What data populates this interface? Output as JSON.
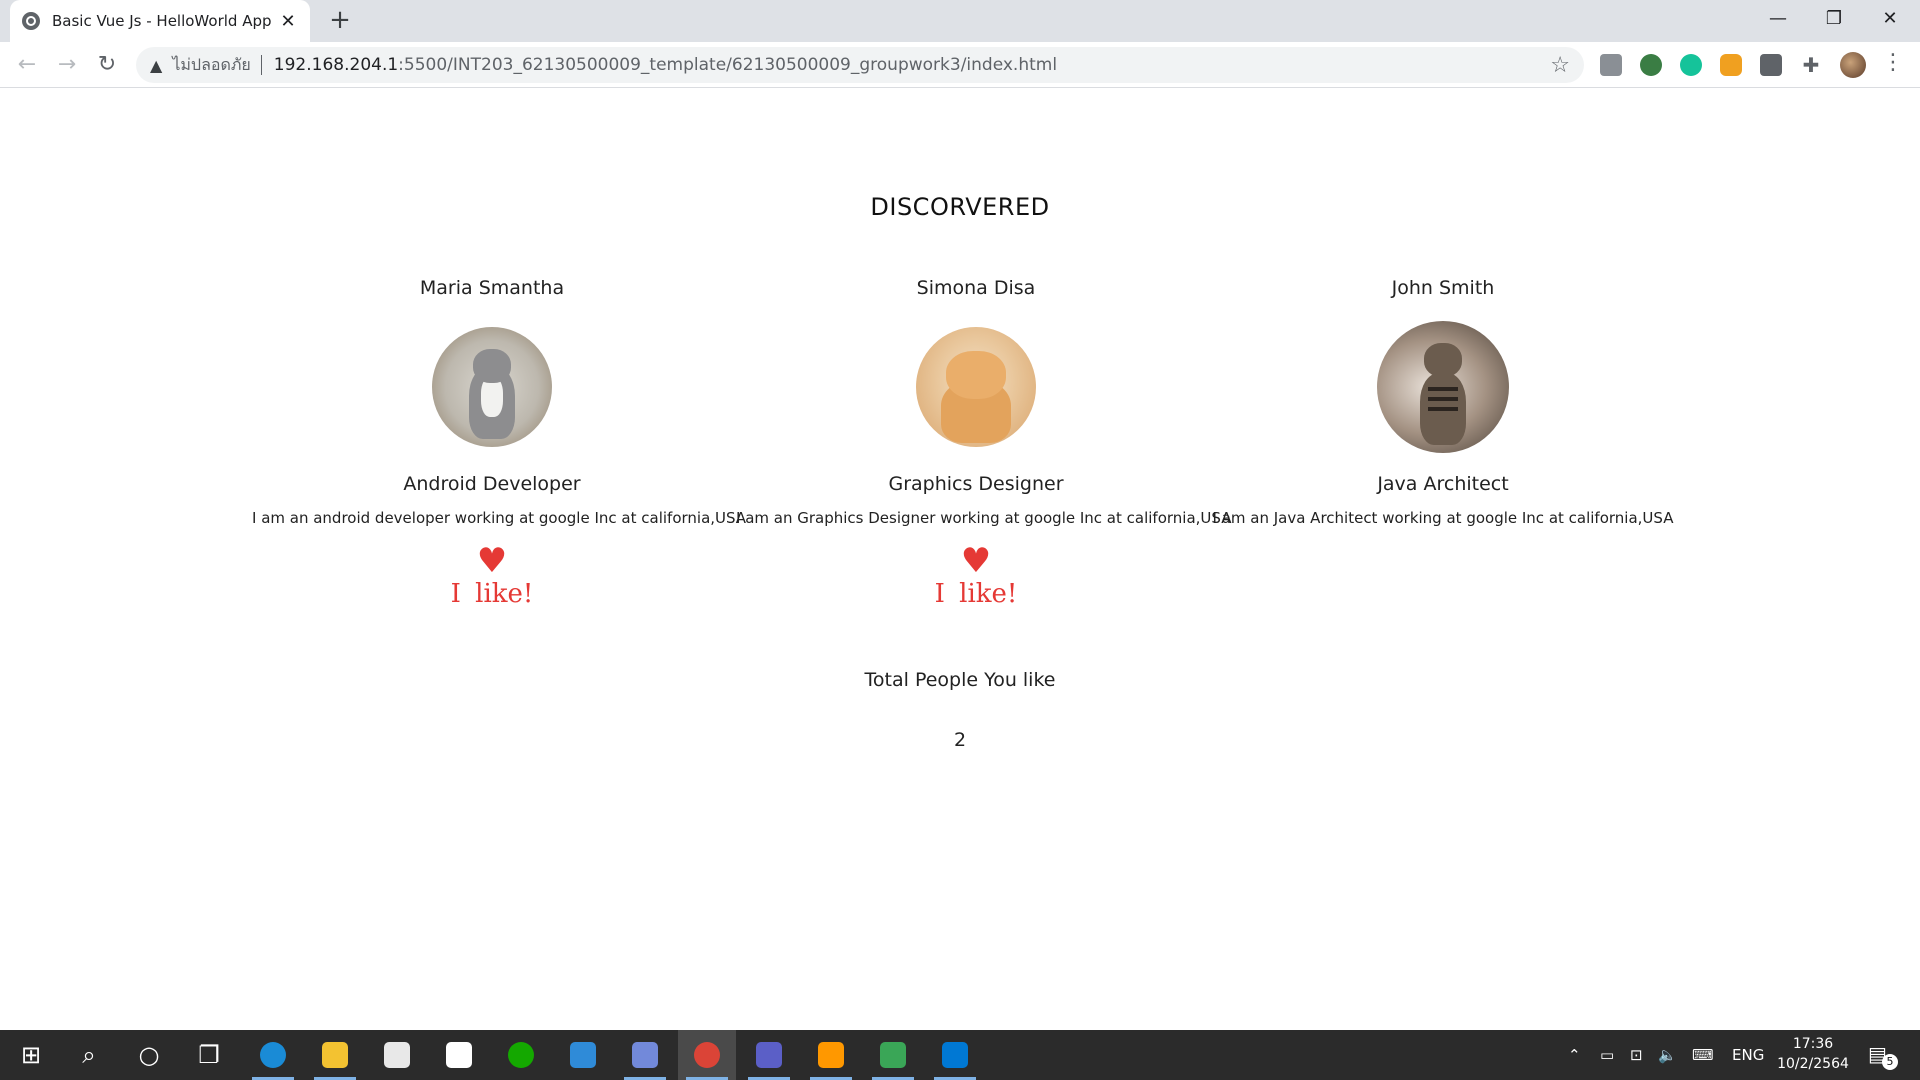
{
  "browser": {
    "tab_title": "Basic Vue Js - HelloWorld App",
    "tab_close": "✕",
    "new_tab": "+",
    "insecure_label": "ไม่ปลอดภัย",
    "url_host": "192.168.204.1",
    "url_path": ":5500/INT203_62130500009_template/62130500009_groupwork3/index.html",
    "window_controls": {
      "minimize": "—",
      "maximize": "❐",
      "close": "✕"
    }
  },
  "page": {
    "title": "DISCORVERED",
    "people": [
      {
        "name": "Maria Smantha",
        "role": "Android Developer",
        "description": "I am an android developer working at google Inc at california,USA",
        "liked": true
      },
      {
        "name": "Simona Disa",
        "role": "Graphics Designer",
        "description": "I am an Graphics Designer working at google Inc at california,USA",
        "liked": true
      },
      {
        "name": "John Smith",
        "role": "Java Architect",
        "description": "I am an Java Architect working at google Inc at california,USA",
        "liked": false
      }
    ],
    "like_label": "I like!",
    "total_label": "Total People You like",
    "total_count": "2"
  },
  "taskbar": {
    "language": "ENG",
    "time": "17:36",
    "date": "10/2/2564",
    "notification_count": "5",
    "accent_color": "#7fb2e5"
  },
  "colors": {
    "like_red": "#e53935",
    "taskbar_bg": "#2b2b2b"
  }
}
